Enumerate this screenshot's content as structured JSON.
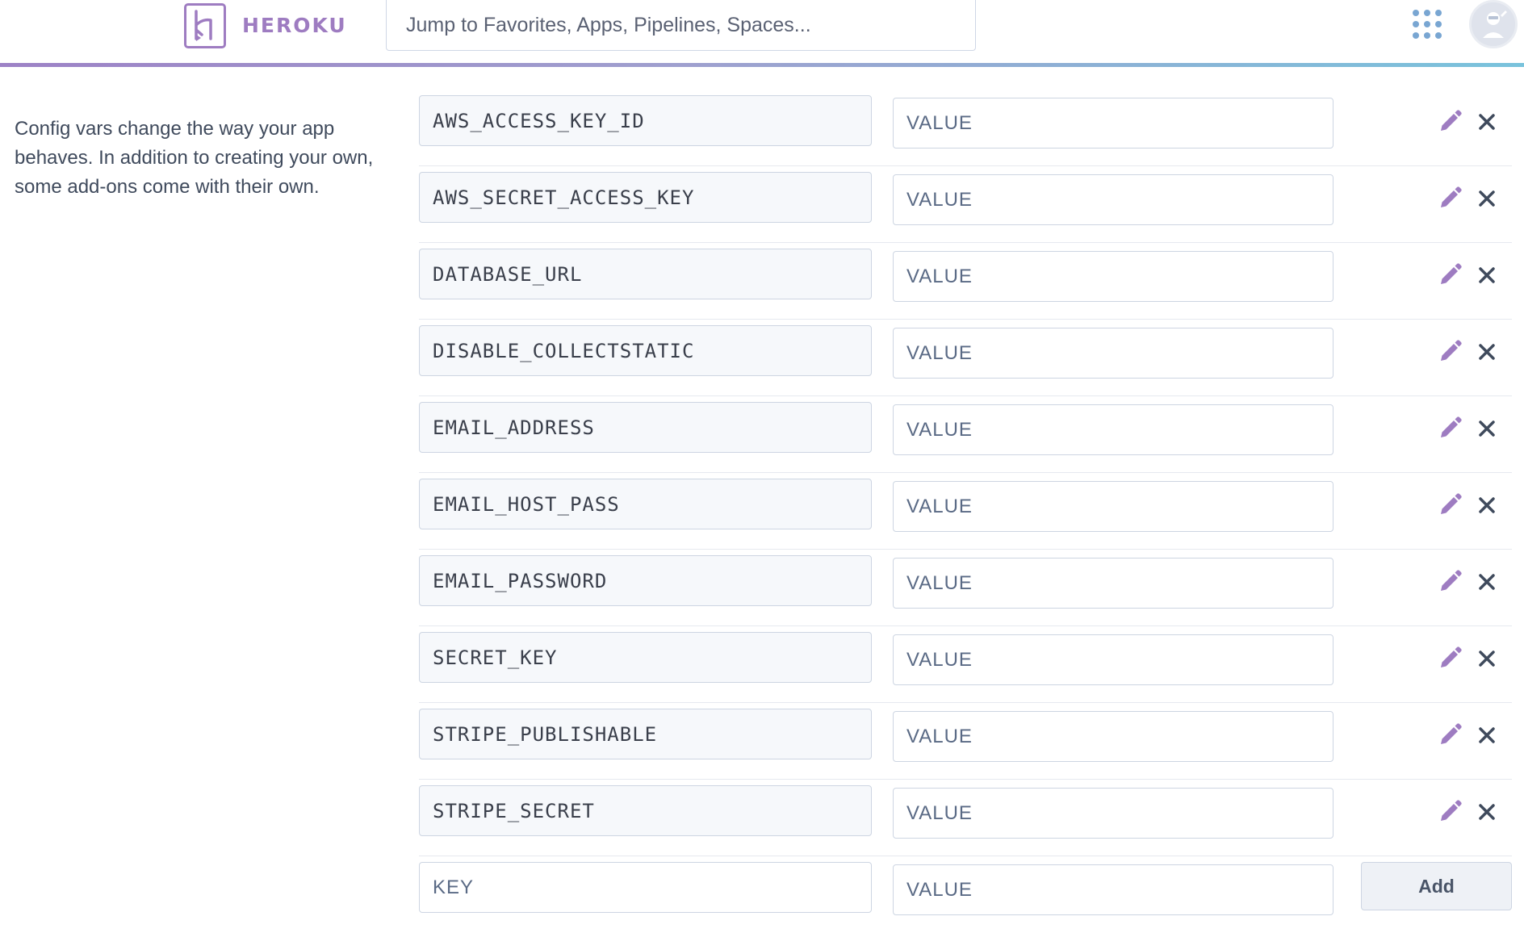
{
  "header": {
    "brand": "HEROKU",
    "search_placeholder": "Jump to Favorites, Apps, Pipelines, Spaces...",
    "apps_icon": "apps-grid-icon",
    "avatar_icon": "user-avatar-icon",
    "accent_color": "#9e7cc1"
  },
  "description": "Config vars change the way your app behaves. In addition to creating your own, some add-ons come with their own.",
  "config_vars": [
    {
      "key": "AWS_ACCESS_KEY_ID",
      "value_placeholder": "VALUE"
    },
    {
      "key": "AWS_SECRET_ACCESS_KEY",
      "value_placeholder": "VALUE"
    },
    {
      "key": "DATABASE_URL",
      "value_placeholder": "VALUE"
    },
    {
      "key": "DISABLE_COLLECTSTATIC",
      "value_placeholder": "VALUE"
    },
    {
      "key": "EMAIL_ADDRESS",
      "value_placeholder": "VALUE"
    },
    {
      "key": "EMAIL_HOST_PASS",
      "value_placeholder": "VALUE"
    },
    {
      "key": "EMAIL_PASSWORD",
      "value_placeholder": "VALUE"
    },
    {
      "key": "SECRET_KEY",
      "value_placeholder": "VALUE"
    },
    {
      "key": "STRIPE_PUBLISHABLE",
      "value_placeholder": "VALUE"
    },
    {
      "key": "STRIPE_SECRET",
      "value_placeholder": "VALUE"
    }
  ],
  "new_var": {
    "key_placeholder": "KEY",
    "value_placeholder": "VALUE",
    "add_label": "Add"
  },
  "icons": {
    "edit": "pencil-icon",
    "remove": "close-icon"
  }
}
